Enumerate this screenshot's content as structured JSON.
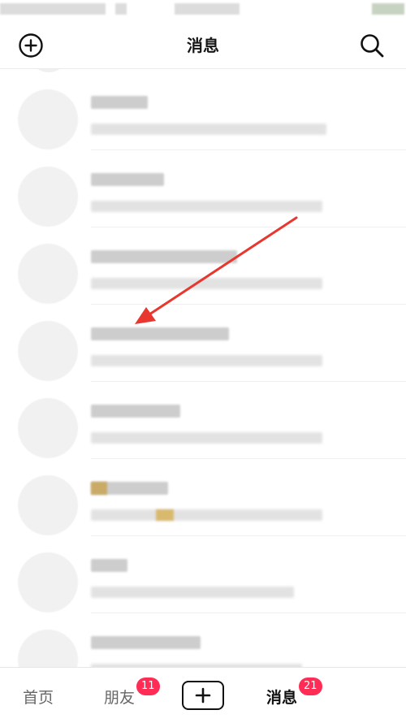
{
  "header": {
    "title": "消息",
    "left_icon": "plus-circle-icon",
    "right_icon": "search-icon"
  },
  "conversations": [
    {
      "name": "",
      "preview": "",
      "obscured": true
    },
    {
      "name": "",
      "preview": "",
      "obscured": true
    },
    {
      "name": "",
      "preview": "",
      "obscured": true
    },
    {
      "name": "",
      "preview": "",
      "obscured": true
    },
    {
      "name": "",
      "preview": "",
      "obscured": true
    },
    {
      "name": "",
      "preview": "",
      "obscured": true
    },
    {
      "name": "",
      "preview": "",
      "obscured": true
    },
    {
      "name": "",
      "preview": "",
      "obscured": true
    }
  ],
  "annotation": {
    "type": "arrow",
    "color": "#e8372f"
  },
  "tabbar": {
    "home_label": "首页",
    "friends_label": "朋友",
    "friends_badge": "11",
    "create_icon": "plus-icon",
    "messages_label": "消息",
    "messages_badge": "21"
  },
  "colors": {
    "badge": "#ff2c55",
    "annotation": "#e8372f"
  }
}
